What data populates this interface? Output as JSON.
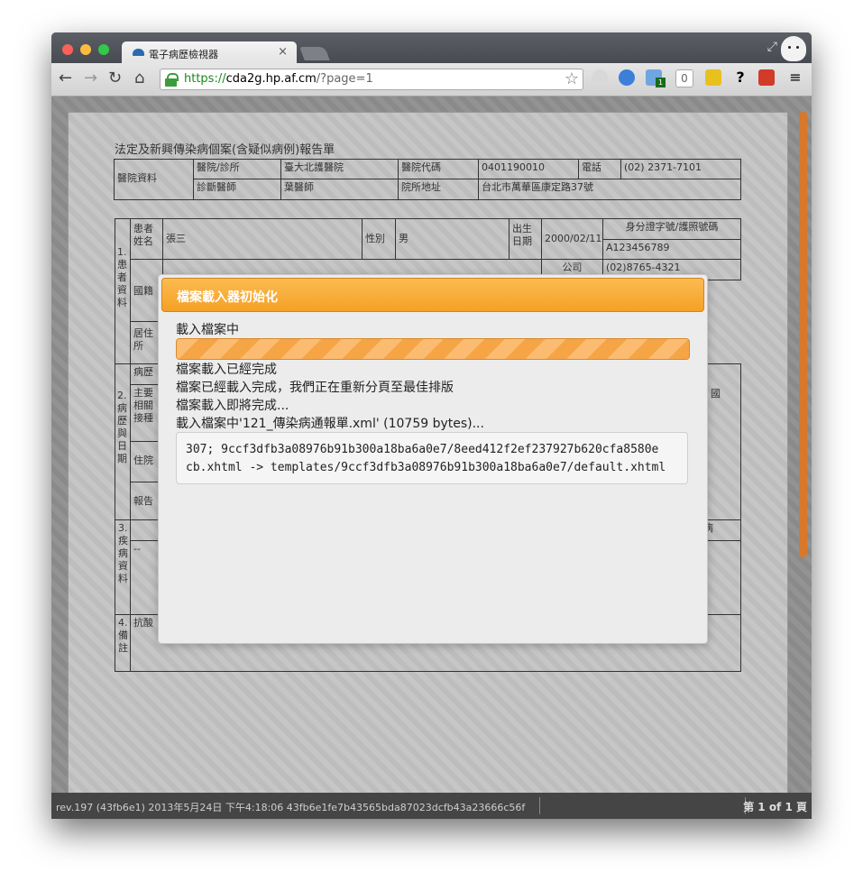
{
  "browser": {
    "tab_title": "電子病歷檢視器",
    "tab_close": "×",
    "url_scheme": "https://",
    "url_host": "cda2g.hp.af.cm",
    "url_rest": "/?page=1",
    "ext_badge_1": "1",
    "ext_badge_0": "0"
  },
  "document": {
    "title": "法定及新興傳染病個案(含疑似病例)報告單",
    "hospital": {
      "section_label": "醫院資料",
      "clinic_label": "醫院/診所",
      "clinic_value": "臺大北護醫院",
      "code_label": "醫院代碼",
      "code_value": "0401190010",
      "phone_label": "電話",
      "phone_value": "(02) 2371-7101",
      "doctor_label": "診斷醫師",
      "doctor_value": "葉醫師",
      "address_label": "院所地址",
      "address_value": "台北市萬華區康定路37號"
    },
    "patient": {
      "section_label": "1.患者資料",
      "name_label": "患者姓名",
      "name_value": "張三",
      "sex_label": "性別",
      "sex_value": "男",
      "birth_label": "出生日期",
      "birth_value": "2000/02/11",
      "id_label": "身分證字號/護照號碼",
      "id_value": "A123456789",
      "company_label": "公司",
      "company_phone": "(02)8765-4321",
      "nationality_label": "國籍",
      "residence_label": "居住所"
    },
    "history": {
      "section_label": "2.病歷與日期",
      "history_label": "病歷",
      "main_label": "主要",
      "related_label": "相關",
      "vaccine_label": "接種",
      "hospital_label": "住院",
      "report_label": "報告",
      "right_text": "國"
    },
    "disease": {
      "section_label": "3.疾病資料",
      "dash": "--",
      "right_text": "病"
    },
    "remarks": {
      "section_label": "4.備註",
      "text": "抗酸"
    }
  },
  "dialog": {
    "title": "檔案載入器初始化",
    "loading": "載入檔案中",
    "progress": 1.0,
    "line1": "檔案載入已經完成",
    "line2": "檔案已經載入完成，我們正在重新分頁至最佳排版",
    "line3": "檔案載入即將完成...",
    "line4": "載入檔案中'121_傳染病通報單.xml' (10759 bytes)...",
    "code_line1": "307; 9ccf3dfb3a08976b91b300a18ba6a0e7/8eed412f2ef237927b620cfa8580e",
    "code_line2": "cb.xhtml -> templates/9ccf3dfb3a08976b91b300a18ba6a0e7/default.xhtml"
  },
  "status": {
    "revision": "rev.197 (43fb6e1) 2013年5月24日 下午4:18:06 43fb6e1fe7b43565bda87023dcfb43a23666c56f",
    "page": "第 1 of 1 頁"
  },
  "colors": {
    "accent": "#f5a125",
    "scroll": "#d7782a",
    "url_green": "#1a8a1a"
  }
}
